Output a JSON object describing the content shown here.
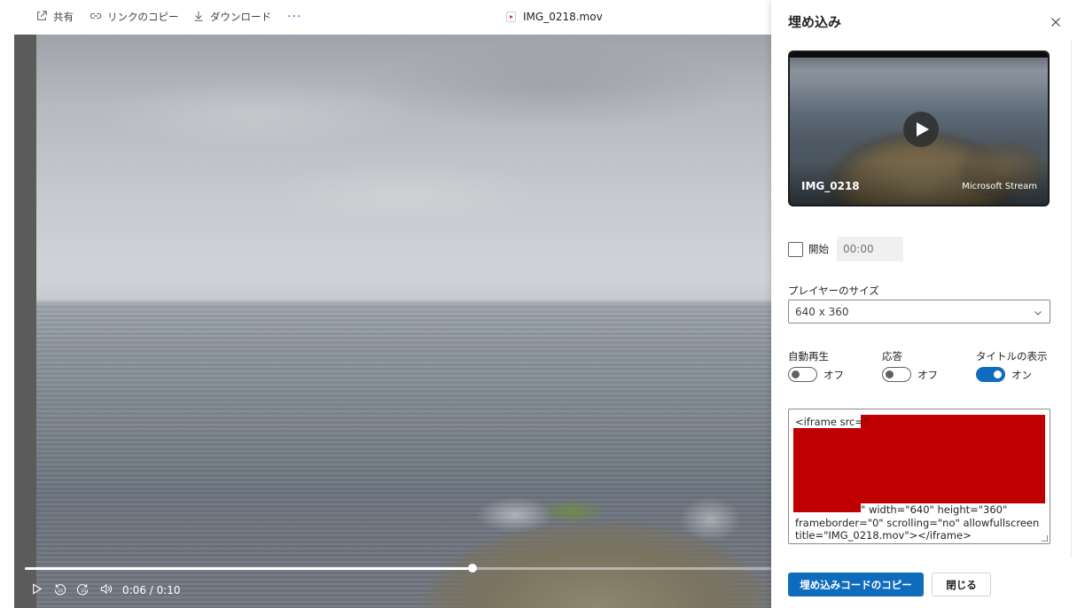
{
  "toolbar": {
    "share_label": "共有",
    "copy_link_label": "リンクのコピー",
    "download_label": "ダウンロード",
    "more_label": "···",
    "file_title": "IMG_0218.mov"
  },
  "player": {
    "time_display": "0:06 / 0:10",
    "progress_fraction": 0.6,
    "controls": [
      "play-icon",
      "rewind-10-icon",
      "forward-10-icon",
      "volume-icon"
    ]
  },
  "panel": {
    "title": "埋め込み",
    "preview": {
      "video_name": "IMG_0218",
      "brand": "Microsoft Stream"
    },
    "start": {
      "label": "開始",
      "checked": false,
      "time_placeholder": "00:00"
    },
    "player_size": {
      "label": "プレイヤーのサイズ",
      "selected": "640 x 360"
    },
    "toggles": [
      {
        "label": "自動再生",
        "state": "オフ",
        "on": false
      },
      {
        "label": "応答",
        "state": "オフ",
        "on": false
      },
      {
        "label": "タイトルの表示",
        "state": "オン",
        "on": true
      }
    ],
    "embed_code": {
      "prefix": "<iframe src=\"",
      "line1": "\" width=\"640\" height=\"360\"",
      "line2": "frameborder=\"0\" scrolling=\"no\" allowfullscreen",
      "line3": "title=\"IMG_0218.mov\"></iframe>"
    },
    "copy_button_label": "埋め込みコードのコピー",
    "close_button_label": "閉じる"
  },
  "colors": {
    "accent": "#0f6cbd",
    "redaction": "#c00000"
  }
}
